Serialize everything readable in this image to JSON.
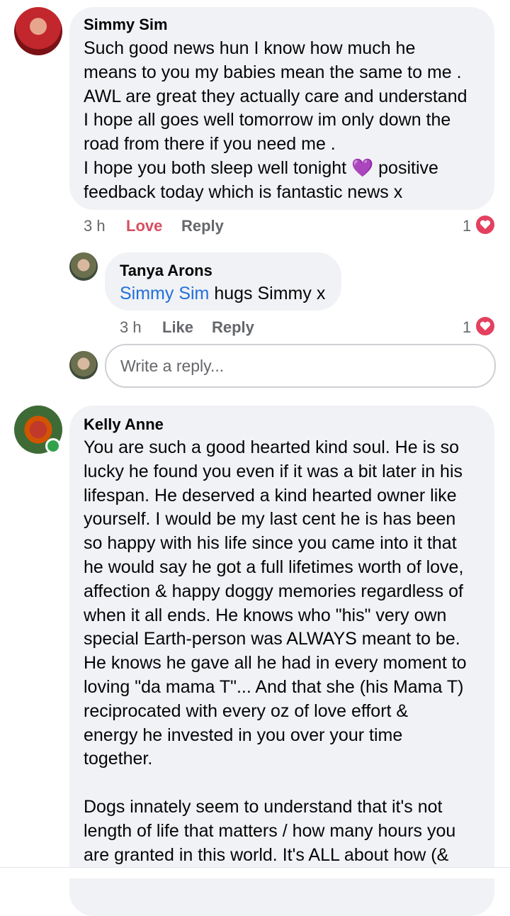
{
  "comments": [
    {
      "author": "Simmy Sim",
      "lines": [
        "Such good news hun I know how much he",
        "means to you my babies mean the same to me .",
        "AWL are great they actually care and understand",
        "I hope all goes well tomorrow im only down the",
        "road from there  if you need me .",
        "I hope you both sleep well tonight",
        "feedback today which is fantastic news x"
      ],
      "emoji": "💜",
      "line6_tail": "positive",
      "time": "3 h",
      "action_love": "Love",
      "action_reply": "Reply",
      "reaction_count": "1",
      "reaction_icon": "heart-icon"
    },
    {
      "author": "Tanya Arons",
      "tag": "Simmy Sim",
      "text": "hugs Simmy x",
      "time": "3 h",
      "action_like": "Like",
      "action_reply": "Reply",
      "reaction_count": "1",
      "reaction_icon": "heart-icon"
    },
    {
      "author": "Kelly Anne",
      "lines": [
        "You are such a good hearted kind soul. He is so",
        "lucky he found you even if it was a bit later in his",
        "lifespan. He deserved a kind hearted owner like",
        "yourself. I would be my last cent he is has been",
        "so happy with his life since you came into it that",
        "he would say he got a full lifetimes worth of love,",
        "affection & happy doggy memories regardless of",
        "when it all ends. He knows who \"his\" very own",
        "special Earth-person was ALWAYS meant to be.",
        "He knows he gave all he had in every moment to",
        "loving \"da mama T\"... And that she (his Mama T)",
        "reciprocated with every oz of love effort &",
        "energy he invested in you over your time",
        "together.",
        "",
        "Dogs innately seem to understand that it's not",
        "length of life that matters / how many hours you",
        "are granted in this world. It's ALL about how (&"
      ]
    }
  ],
  "reply_box": {
    "placeholder": "Write a reply..."
  },
  "colors": {
    "bubble": "#f0f2f5",
    "love": "#d64f5f",
    "tag": "#216fdb",
    "heart": "#e4405f",
    "online": "#31a24c"
  }
}
